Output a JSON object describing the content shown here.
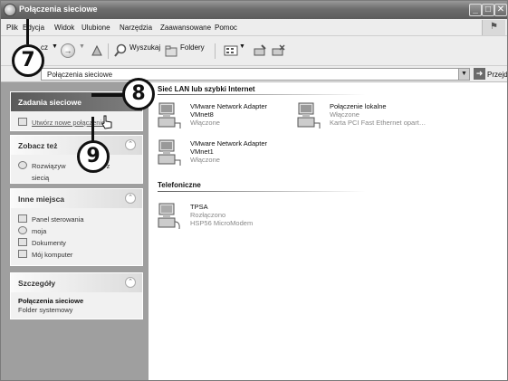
{
  "window": {
    "title": "Połączenia sieciowe"
  },
  "menu": [
    "Plik",
    "Edycja",
    "Widok",
    "Ulubione",
    "Narzędzia",
    "Zaawansowane",
    "Pomoc"
  ],
  "toolbar": {
    "back_label": "cz",
    "search_label": "Wyszukaj",
    "folders_label": "Foldery"
  },
  "address": {
    "value": "Połączenia sieciowe",
    "go_label": "Przejdź"
  },
  "panels": {
    "network_tasks": {
      "title": "Zadania sieciowe",
      "items": [
        "Utwórz nowe połączenie"
      ]
    },
    "see_also": {
      "title": "Zobacz też",
      "items": [
        "Rozwiązyw",
        "dw z",
        "siecią"
      ]
    },
    "other_places": {
      "title": "Inne miejsca",
      "items": [
        "Panel sterowania",
        "moja",
        "Dokumenty",
        "Mój komputer"
      ]
    },
    "details": {
      "title": "Szczegóły",
      "name": "Połączenia sieciowe",
      "type": "Folder systemowy"
    }
  },
  "groups": {
    "lan": {
      "title": "Sieć LAN lub szybki Internet",
      "connections": [
        {
          "name": "VMware Network Adapter",
          "line2": "VMnet8",
          "status": "Włączone"
        },
        {
          "name": "Połączenie lokalne",
          "line2": "Włączone",
          "status": "Karta PCI Fast Ethernet opart…"
        },
        {
          "name": "VMware Network Adapter",
          "line2": "VMnet1",
          "status": "Włączone"
        }
      ]
    },
    "dialup": {
      "title": "Telefoniczne",
      "connections": [
        {
          "name": "TPSA",
          "line2": "Rozłączono",
          "status": "HSP56 MicroModem"
        }
      ]
    }
  },
  "callouts": [
    "7",
    "8",
    "9"
  ],
  "icons": [
    "network-connection-icon",
    "dialup-connection-icon",
    "back-icon",
    "forward-icon",
    "search-icon",
    "folders-icon",
    "views-icon",
    "go-arrow-icon"
  ],
  "colors": {
    "titlebar": "#6d6d6d",
    "leftpane": "#9f9f9f",
    "panel": "#f1f1f1"
  }
}
